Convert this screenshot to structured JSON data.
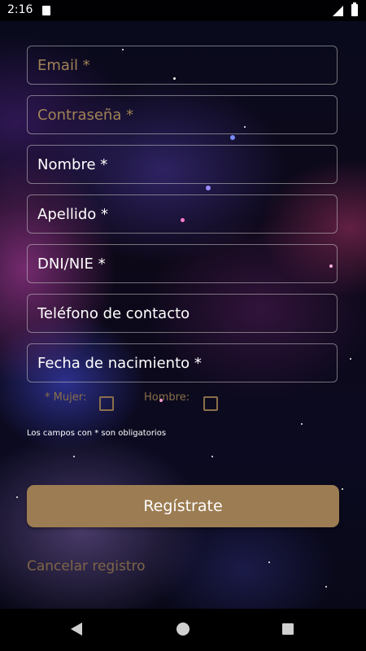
{
  "status_bar": {
    "time": "2:16",
    "icons": [
      "sd-card-icon",
      "signal-icon",
      "battery-icon"
    ]
  },
  "form": {
    "email_placeholder": "Email *",
    "password_placeholder": "Contraseña *",
    "name_placeholder": "Nombre *",
    "surname_placeholder": "Apellido *",
    "dni_placeholder": "DNI/NIE *",
    "phone_placeholder": "Teléfono de contacto",
    "birthdate_placeholder": "Fecha de nacimiento *",
    "gender_female_label": "* Mujer:",
    "gender_male_label": "Hombre:",
    "required_note": "Los campos con * son obligatorios",
    "register_label": "Regístrate",
    "cancel_label": "Cancelar registro"
  },
  "colors": {
    "accent": "#9c7c52",
    "gold_text": "#a08255",
    "field_border": "#c8c8c8"
  },
  "nav_bar": {
    "icons": [
      "back-icon",
      "home-icon",
      "recents-icon"
    ]
  }
}
